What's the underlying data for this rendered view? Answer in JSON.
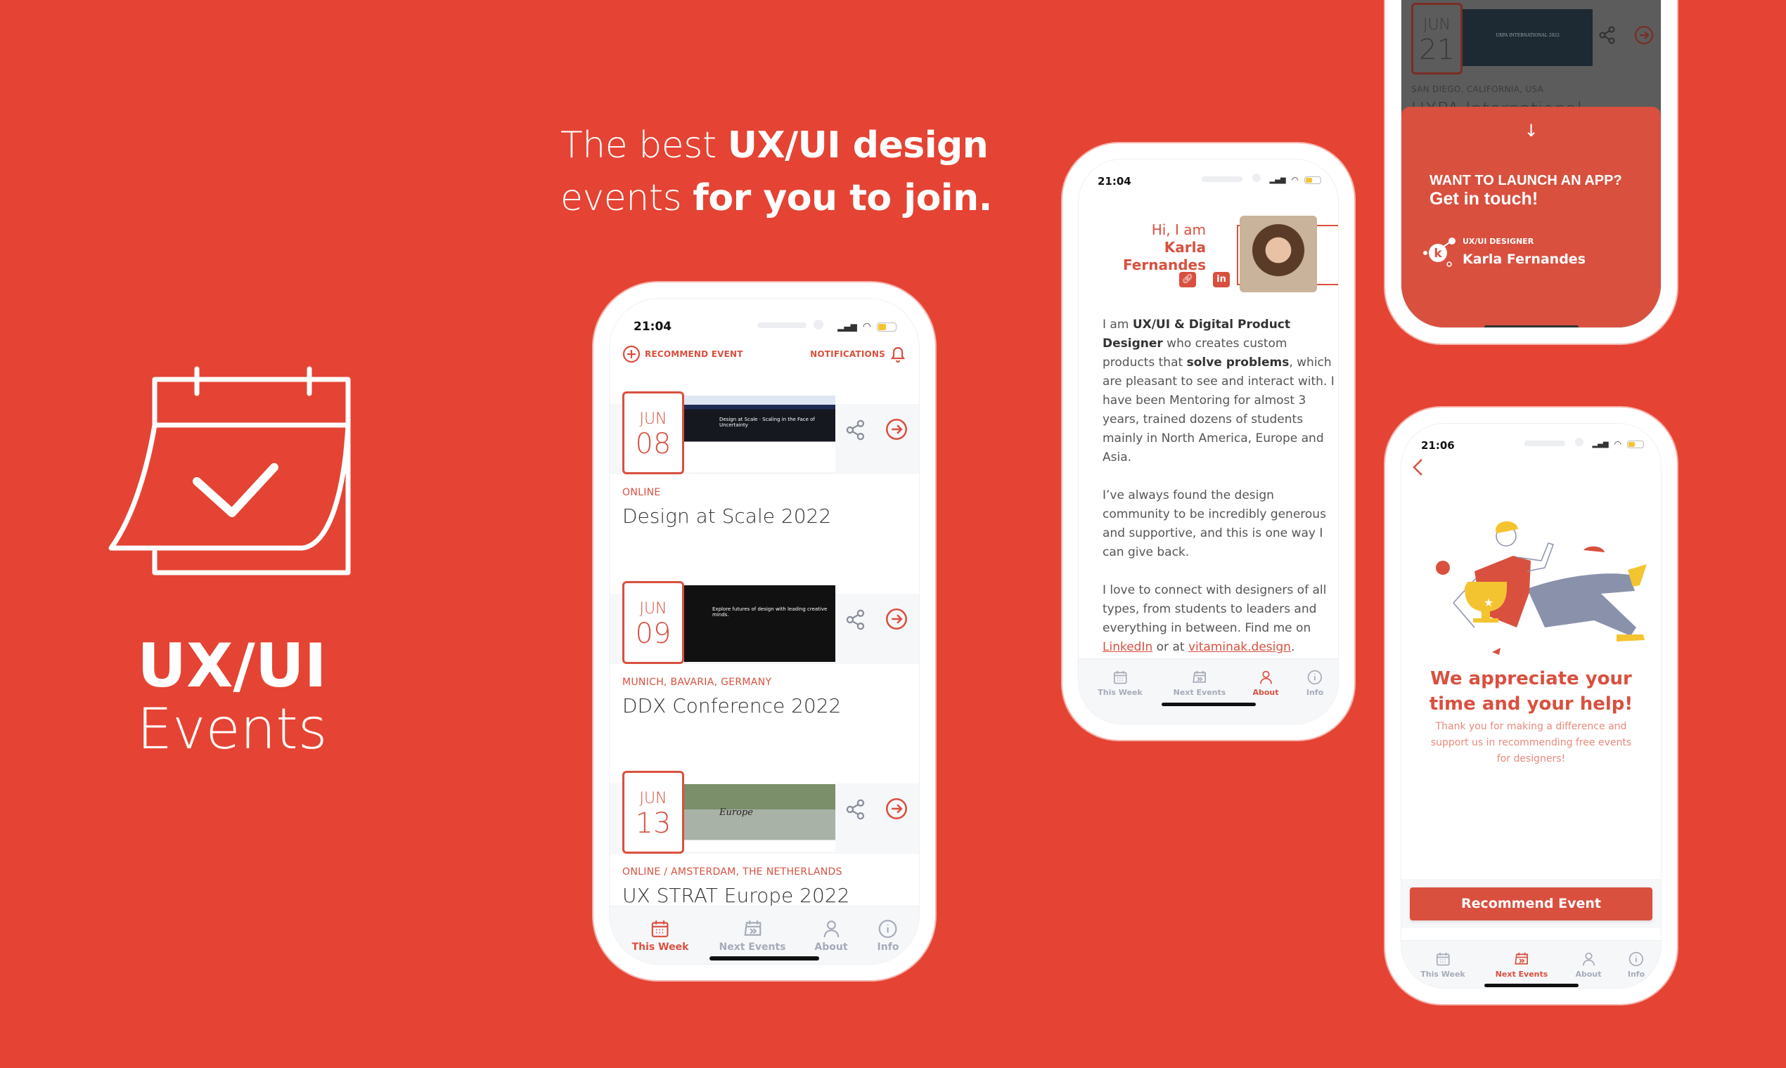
{
  "headline": {
    "line1_regular": "The best ",
    "line1_bold": "UX/UI design",
    "line2_regular": "events ",
    "line2_bold": "for you to join."
  },
  "brand": {
    "title": "UX/UI",
    "subtitle": "Events",
    "icon": "calendar-check-icon"
  },
  "colors": {
    "background": "#E54333",
    "accent": "#D9503F",
    "tab_inactive": "#a5abb8",
    "battery": "#F4C430"
  },
  "tabs": [
    {
      "label": "This Week",
      "icon": "calendar-icon"
    },
    {
      "label": "Next Events",
      "icon": "calendar-next-icon"
    },
    {
      "label": "About",
      "icon": "person-icon"
    },
    {
      "label": "Info",
      "icon": "info-icon"
    }
  ],
  "events_phone": {
    "status_time": "21:04",
    "recommend_label": "RECOMMEND EVENT",
    "notifications_label": "NOTIFICATIONS",
    "active_tab": 0,
    "events": [
      {
        "month": "JUN",
        "day": "08",
        "location": "ONLINE",
        "title": "Design at Scale 2022",
        "thumb_text": "Design at Scale · Scaling in the Face of Uncertainty"
      },
      {
        "month": "JUN",
        "day": "09",
        "location": "MUNICH, BAVARIA, GERMANY",
        "title": "DDX Conference 2022",
        "thumb_text": "Explore futures of design with leading creative minds."
      },
      {
        "month": "JUN",
        "day": "13",
        "location": "ONLINE / AMSTERDAM, THE NETHERLANDS",
        "title": "UX STRAT Europe 2022",
        "thumb_text": "Europe"
      }
    ]
  },
  "about_phone": {
    "status_time": "21:04",
    "greeting": "Hi, I am",
    "name": "Karla Fernandes",
    "p1_a": "I am ",
    "p1_b": "UX/UI & Digital Product Designer",
    "p1_c": " who creates custom products that ",
    "p1_d": "solve problems",
    "p1_e": ", which are pleasant to see and interact with. I have been Mentoring for almost 3 years, trained dozens of students mainly in North America, Europe and Asia.",
    "p2": "I’ve always found the design community to be incredibly generous and supportive, and this is one way I can give back.",
    "p3_a": "I love to connect with designers of all types, from students to leaders and everything in between. Find me on ",
    "p3_link1": "LinkedIn",
    "p3_b": " or at ",
    "p3_link2": "vitaminak.design",
    "p3_c": ".",
    "active_tab": 2
  },
  "promo_phone": {
    "event_month": "JUN",
    "event_day": "21",
    "event_location": "SAN DIEGO, CALIFORNIA, USA",
    "event_title": "UXPA International",
    "thumb_text": "UXPA INTERNATIONAL 2022",
    "cta_line1": "WANT TO LAUNCH AN APP?",
    "cta_line2": "Get in touch!",
    "role": "UX/UI DESIGNER",
    "name": "Karla Fernandes",
    "logo": "k-logo"
  },
  "thanks_phone": {
    "status_time": "21:06",
    "heading_line1": "We appreciate your",
    "heading_line2": "time and your help!",
    "body": "Thank you for making a difference and support us in recommending free events for designers!",
    "button_label": "Recommend Event",
    "active_tab": 1
  }
}
